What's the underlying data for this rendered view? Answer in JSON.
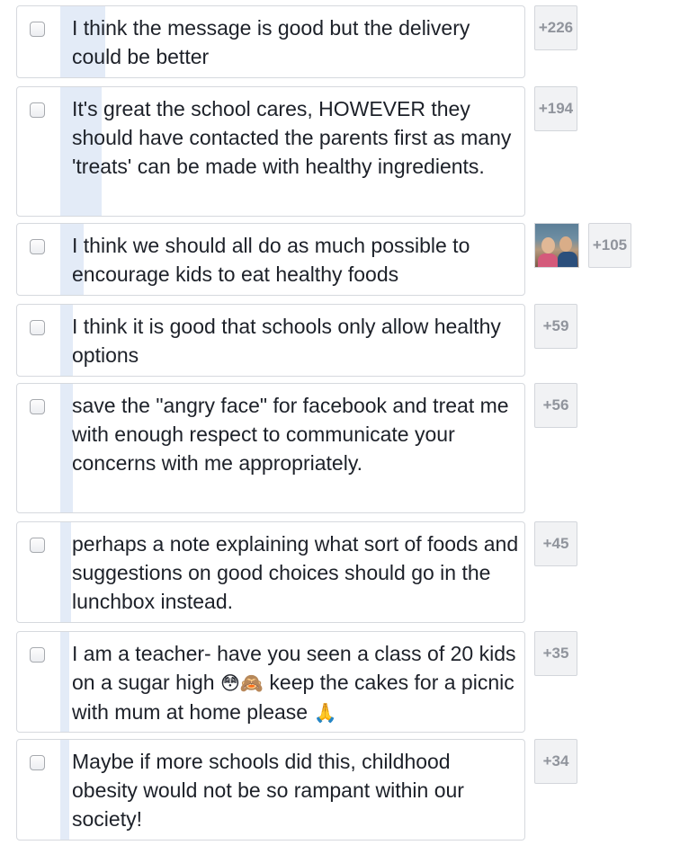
{
  "items": [
    {
      "text": "I think the message is good but the delivery could be better",
      "count": "+226"
    },
    {
      "text": "It's great the school cares, HOWEVER they should have contacted the parents first as many 'treats' can be made with healthy ingredients.",
      "count": "+194"
    },
    {
      "text": "I think we should all do as much possible to encourage kids to eat healthy foods",
      "count": "+105"
    },
    {
      "text": "I think it is good that schools only allow healthy options",
      "count": "+59"
    },
    {
      "text": "save the \"angry face\" for facebook and treat me with enough respect to communicate your concerns with me appropriately.",
      "count": "+56"
    },
    {
      "text": "perhaps a note explaining what sort of foods and suggestions on good choices should go in the lunchbox instead.",
      "count": "+45"
    },
    {
      "text_before": "I am a teacher- have you seen a class of 20 kids on a sugar high ",
      "emoji_flushed": "😳",
      "emoji_monkey": "🙈",
      "text_middle": " keep the cakes for a picnic with mum at home please ",
      "emoji_pray": "🙏",
      "count": "+35"
    },
    {
      "text": "Maybe if more schools did this, childhood obesity would not be so rampant within our society!",
      "count": "+34"
    }
  ],
  "icons": {
    "checkbox": "checkbox-icon",
    "avatar": "voter-avatar"
  },
  "colors": {
    "bar": "#e3ebf7",
    "count_text": "#90949c",
    "border": "#d6d9de"
  }
}
